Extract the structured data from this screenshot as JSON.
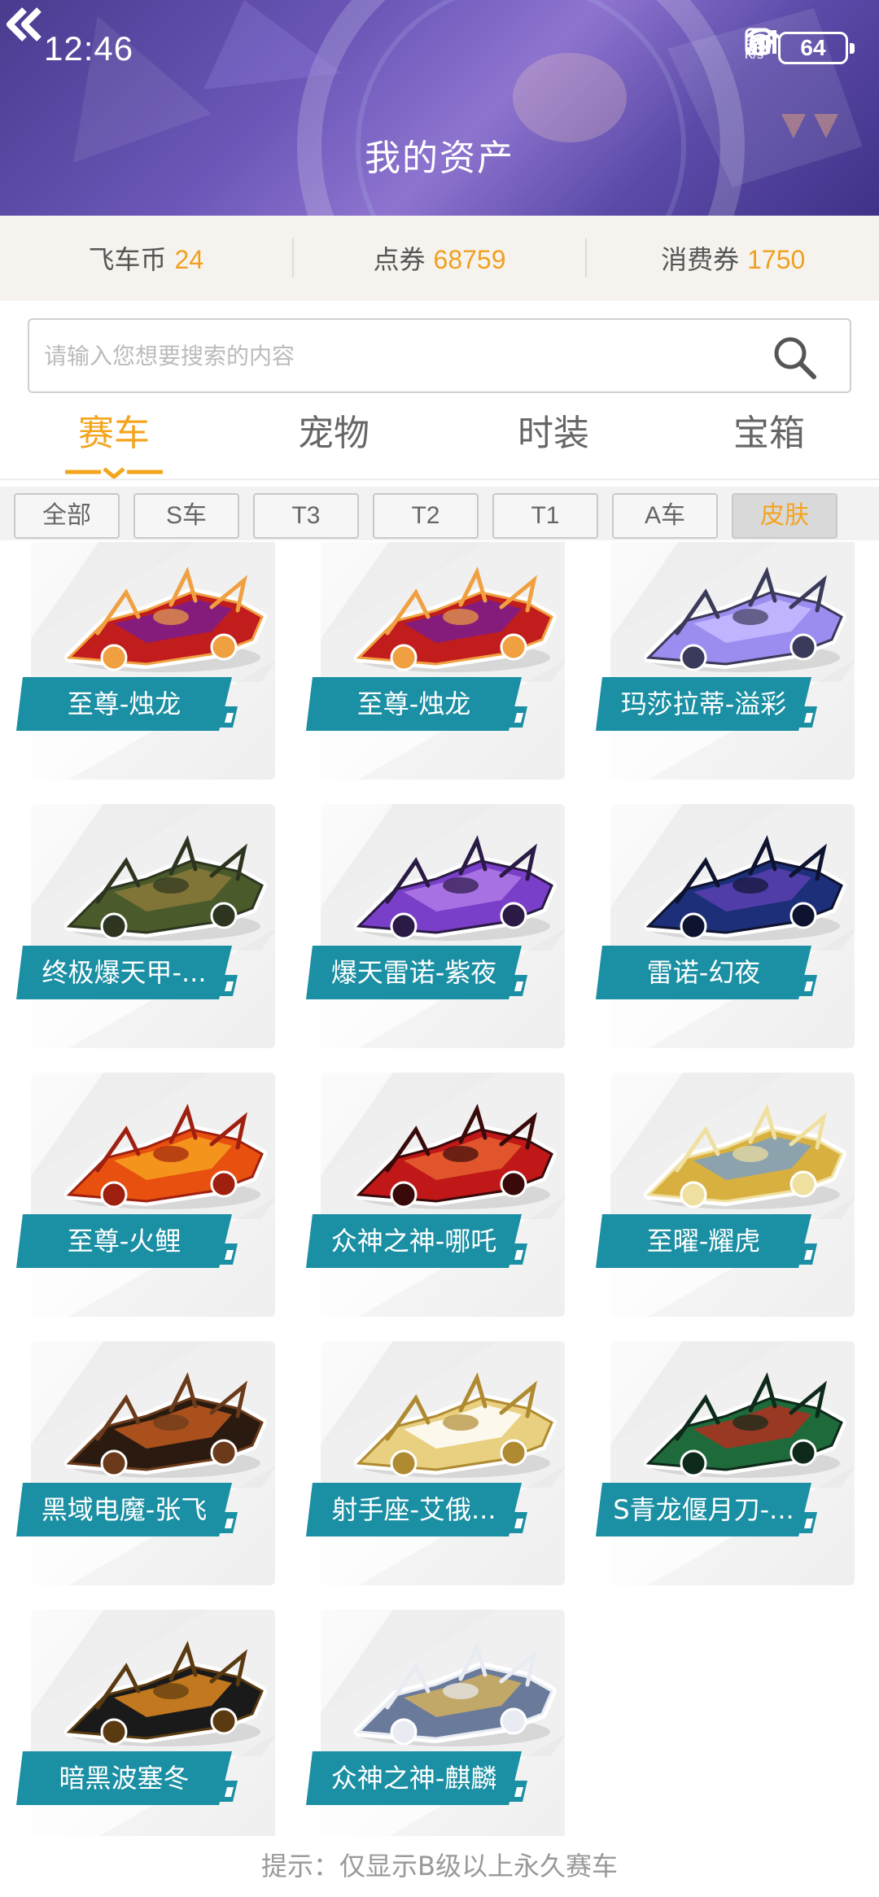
{
  "status_bar": {
    "time": "12:46",
    "net_speed_value": "3.2",
    "net_speed_unit": "K/s",
    "battery": "64"
  },
  "header": {
    "title": "我的资产"
  },
  "assets": [
    {
      "label": "飞车币",
      "value": "24"
    },
    {
      "label": "点券",
      "value": "68759"
    },
    {
      "label": "消费券",
      "value": "1750"
    }
  ],
  "search": {
    "placeholder": "请输入您想要搜索的内容",
    "value": ""
  },
  "tabs": [
    {
      "label": "赛车",
      "active": true
    },
    {
      "label": "宠物",
      "active": false
    },
    {
      "label": "时装",
      "active": false
    },
    {
      "label": "宝箱",
      "active": false
    }
  ],
  "filters": [
    {
      "label": "全部",
      "active": false
    },
    {
      "label": "S车",
      "active": false
    },
    {
      "label": "T3",
      "active": false
    },
    {
      "label": "T2",
      "active": false
    },
    {
      "label": "T1",
      "active": false
    },
    {
      "label": "A车",
      "active": false
    },
    {
      "label": "皮肤",
      "active": true
    }
  ],
  "cars": [
    {
      "name": "至尊-烛龙",
      "colors": [
        "#c11d1d",
        "#7a1c8c",
        "#f0a040"
      ]
    },
    {
      "name": "至尊-烛龙",
      "colors": [
        "#c11d1d",
        "#7a1c8c",
        "#f0a040"
      ]
    },
    {
      "name": "玛莎拉蒂-溢彩",
      "colors": [
        "#9b8cf0",
        "#c5bbff",
        "#3a3a5a"
      ]
    },
    {
      "name": "终极爆天甲-...",
      "colors": [
        "#4a5a2a",
        "#8a7a3a",
        "#2d3520"
      ]
    },
    {
      "name": "爆天雷诺-紫夜",
      "colors": [
        "#7a3fc9",
        "#b07ae8",
        "#2a1a45"
      ]
    },
    {
      "name": "雷诺-幻夜",
      "colors": [
        "#1e2f7a",
        "#5a3fb0",
        "#0e1430"
      ]
    },
    {
      "name": "至尊-火鲤",
      "colors": [
        "#e8500f",
        "#f7a020",
        "#a02010"
      ]
    },
    {
      "name": "众神之神-哪吒",
      "colors": [
        "#c01818",
        "#e86030",
        "#3a0a0a"
      ]
    },
    {
      "name": "至曜-耀虎",
      "colors": [
        "#d8b040",
        "#7fa0c0",
        "#f0e0a0"
      ]
    },
    {
      "name": "黑域电魔-张飞",
      "colors": [
        "#2a1a10",
        "#c05a20",
        "#6a3a1a"
      ]
    },
    {
      "name": "射手座-艾俄...",
      "colors": [
        "#e8d080",
        "#ffffff",
        "#b08a30"
      ]
    },
    {
      "name": "S青龙偃月刀-...",
      "colors": [
        "#1f6a3a",
        "#b03020",
        "#0e2a1a"
      ]
    },
    {
      "name": "暗黑波塞冬",
      "colors": [
        "#1a1a1a",
        "#e08a20",
        "#5a3a10"
      ]
    },
    {
      "name": "众神之神-麒麟",
      "colors": [
        "#6a7a9a",
        "#d0b060",
        "#e8ecf2"
      ]
    }
  ],
  "footer_hint": "提示：仅显示B级以上永久赛车"
}
